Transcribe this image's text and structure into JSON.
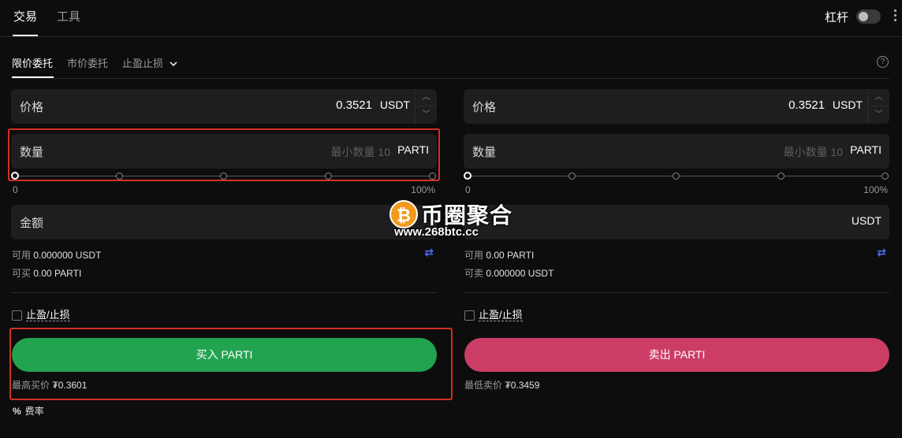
{
  "top_tabs": [
    {
      "label": "交易",
      "active": true
    },
    {
      "label": "工具",
      "active": false
    }
  ],
  "leverage": {
    "label": "杠杆",
    "enabled": false
  },
  "order_tabs": [
    {
      "label": "限价委托",
      "active": true
    },
    {
      "label": "市价委托",
      "active": false
    },
    {
      "label": "止盈止损",
      "active": false
    }
  ],
  "help_icon": "?",
  "buy": {
    "price": {
      "label": "价格",
      "value": "0.3521",
      "unit": "USDT"
    },
    "quantity": {
      "label": "数量",
      "placeholder": "最小数量 10",
      "unit": "PARTI"
    },
    "slider": {
      "min_label": "0",
      "max_label": "100%",
      "value": 0
    },
    "amount": {
      "label": "金额",
      "unit": "USDT"
    },
    "available": {
      "label": "可用",
      "value": "0.000000 USDT"
    },
    "can_trade": {
      "label": "可买",
      "value": "0.00 PARTI"
    },
    "tpsl_label": "止盈/止损",
    "button_label": "买入 PARTI",
    "best_price": {
      "label": "最高买价",
      "value": "₮0.3601"
    }
  },
  "sell": {
    "price": {
      "label": "价格",
      "value": "0.3521",
      "unit": "USDT"
    },
    "quantity": {
      "label": "数量",
      "placeholder": "最小数量 10",
      "unit": "PARTI"
    },
    "slider": {
      "min_label": "0",
      "max_label": "100%",
      "value": 0
    },
    "amount": {
      "label": "金额",
      "unit": "USDT"
    },
    "available": {
      "label": "可用",
      "value": "0.00 PARTI"
    },
    "can_trade": {
      "label": "可卖",
      "value": "0.000000 USDT"
    },
    "tpsl_label": "止盈/止损",
    "button_label": "卖出 PARTI",
    "best_price": {
      "label": "最低卖价",
      "value": "₮0.3459"
    }
  },
  "fee": {
    "icon": "%",
    "label": "费率"
  },
  "watermark": {
    "title": "币圈聚合",
    "url": "www.268btc.cc",
    "coin": "₿"
  },
  "colors": {
    "buy": "#22a350",
    "sell": "#cc3d66",
    "highlight": "#d32f24",
    "swap": "#4a6cf7"
  }
}
